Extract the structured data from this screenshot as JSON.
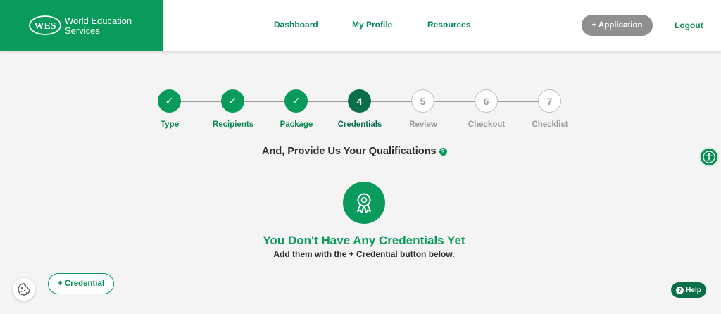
{
  "header": {
    "brand": {
      "logo_text": "WES",
      "line1": "World Education",
      "line2": "Services"
    },
    "nav": [
      {
        "label": "Dashboard"
      },
      {
        "label": "My Profile"
      },
      {
        "label": "Resources"
      }
    ],
    "application_button": "+ Application",
    "logout": "Logout"
  },
  "stepper": {
    "steps": [
      {
        "number": "✓",
        "label": "Type",
        "state": "done"
      },
      {
        "number": "✓",
        "label": "Recipients",
        "state": "done"
      },
      {
        "number": "✓",
        "label": "Package",
        "state": "done"
      },
      {
        "number": "4",
        "label": "Credentials",
        "state": "active"
      },
      {
        "number": "5",
        "label": "Review",
        "state": "pending"
      },
      {
        "number": "6",
        "label": "Checkout",
        "state": "pending"
      },
      {
        "number": "7",
        "label": "Checklist",
        "state": "pending"
      }
    ]
  },
  "section": {
    "title": "And, Provide Us Your Qualifications",
    "help_glyph": "?"
  },
  "empty_state": {
    "title": "You Don't Have Any Credentials Yet",
    "subtitle": "Add them with the + Credential button below."
  },
  "credential_button": "+ Credential",
  "help_button": {
    "label": "Help",
    "glyph": "?"
  },
  "colors": {
    "brand_green": "#0a9a5c",
    "active_green": "#0a6e49",
    "muted_gray": "#9a9a9a"
  },
  "icons": {
    "empty_state": "award-ribbon-icon",
    "cookie": "cookie-icon",
    "accessibility": "accessibility-icon"
  }
}
